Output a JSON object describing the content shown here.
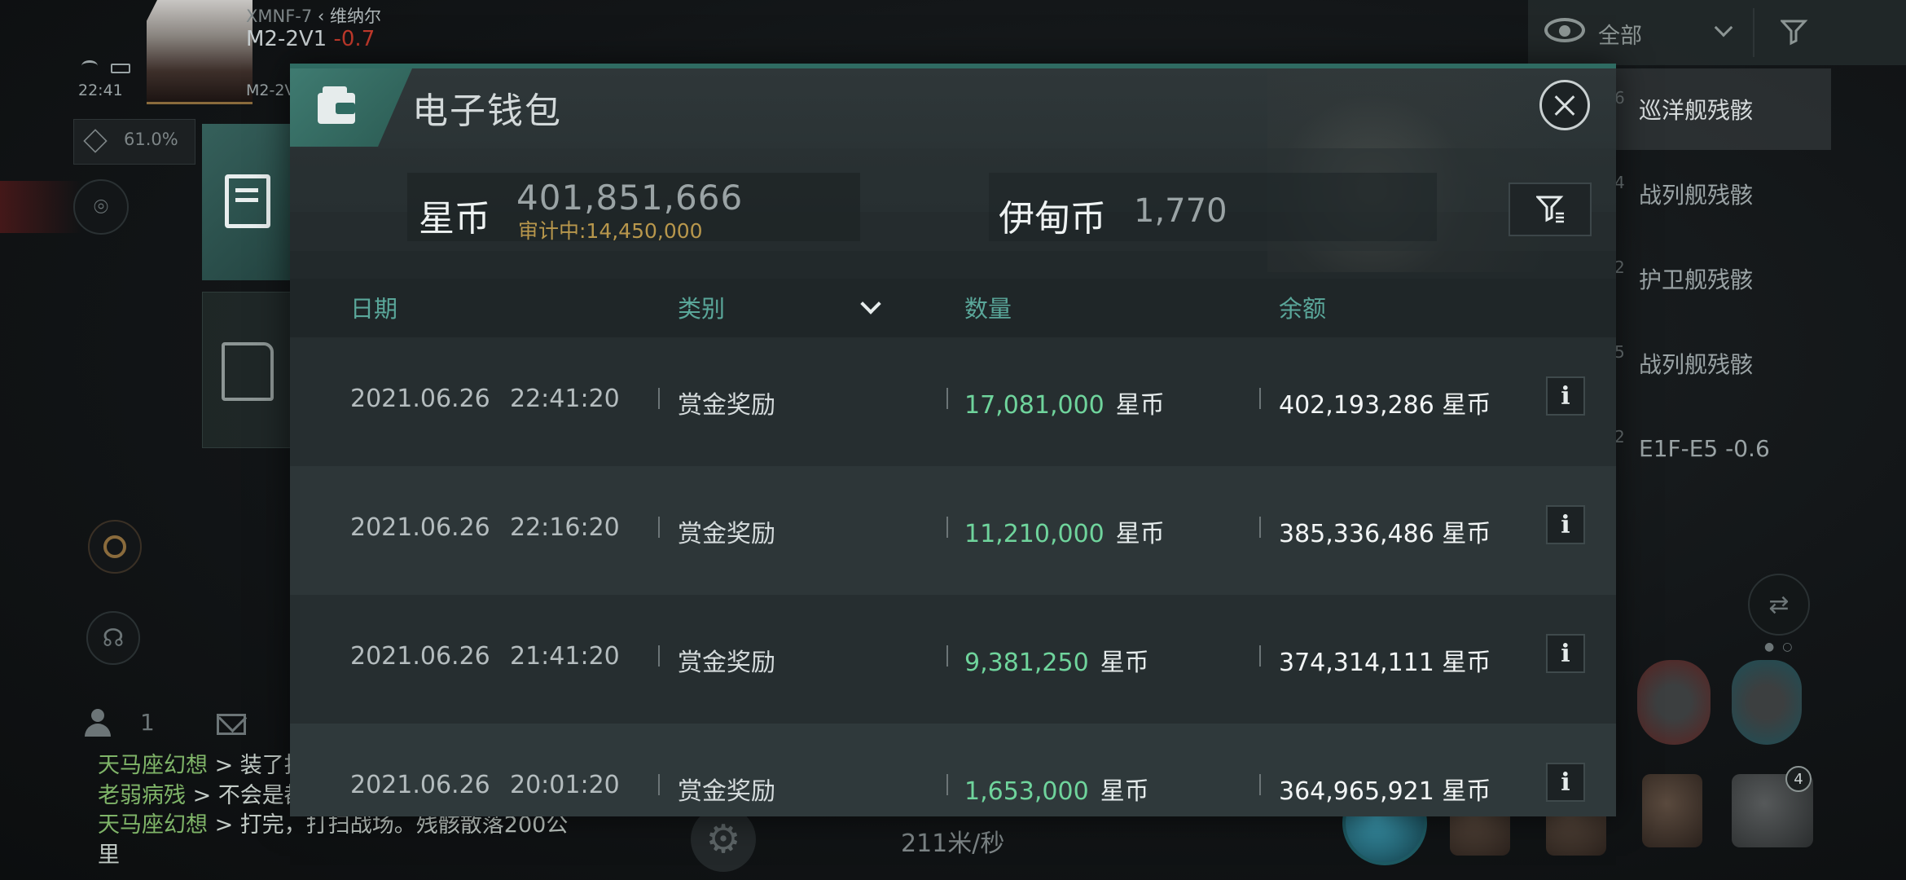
{
  "hud": {
    "system": "XMNF-7",
    "region": "维纳尔",
    "location": "M2-2V1",
    "security": "-0.7",
    "time": "22:41",
    "location_short": "M2-2V",
    "cargo_pct": "61.0%"
  },
  "chat": {
    "user_count": "1",
    "messages": [
      {
        "author": "天马座幻想",
        "text": " > 装了抄"
      },
      {
        "author": "老弱病残",
        "text": " > 不会是都"
      },
      {
        "author": "天马座幻想",
        "text": " > 打完，打扫战场。残骸散落200公里"
      }
    ]
  },
  "ship": {
    "speed": "211米/秒"
  },
  "overview": {
    "filter_label": "全部",
    "items": [
      {
        "dist": "6",
        "label": "巡洋舰残骸",
        "selected": true
      },
      {
        "dist": "4",
        "label": "战列舰残骸",
        "selected": false
      },
      {
        "dist": "2",
        "label": "护卫舰残骸",
        "selected": false
      },
      {
        "dist": "5",
        "label": "战列舰残骸",
        "selected": false
      },
      {
        "dist": "2",
        "label": "E1F-E5 -0.6",
        "selected": false
      }
    ],
    "module_badge": "4"
  },
  "wallet": {
    "title": "电子钱包",
    "star_coin_label": "星币",
    "star_coin_amount": "401,851,666",
    "audit_label": "审计中:14,450,000",
    "isk_label": "伊甸币",
    "isk_amount": "1,770",
    "columns": {
      "date": "日期",
      "category": "类别",
      "quantity": "数量",
      "balance": "余额"
    },
    "rows": [
      {
        "date": "2021.06.26",
        "time": "22:41:20",
        "category": "赏金奖励",
        "quantity": "17,081,000",
        "quantity_unit": "星币",
        "balance": "402,193,286 星币"
      },
      {
        "date": "2021.06.26",
        "time": "22:16:20",
        "category": "赏金奖励",
        "quantity": "11,210,000",
        "quantity_unit": "星币",
        "balance": "385,336,486 星币"
      },
      {
        "date": "2021.06.26",
        "time": "21:41:20",
        "category": "赏金奖励",
        "quantity": "9,381,250",
        "quantity_unit": "星币",
        "balance": "374,314,111 星币"
      },
      {
        "date": "2021.06.26",
        "time": "20:01:20",
        "category": "赏金奖励",
        "quantity": "1,653,000",
        "quantity_unit": "星币",
        "balance": "364,965,921 星币"
      }
    ],
    "colors": {
      "accent": "#2f6b62",
      "header_text": "#5aa79a",
      "positive_amount": "#6fd49c",
      "audit": "#b8974c"
    }
  }
}
